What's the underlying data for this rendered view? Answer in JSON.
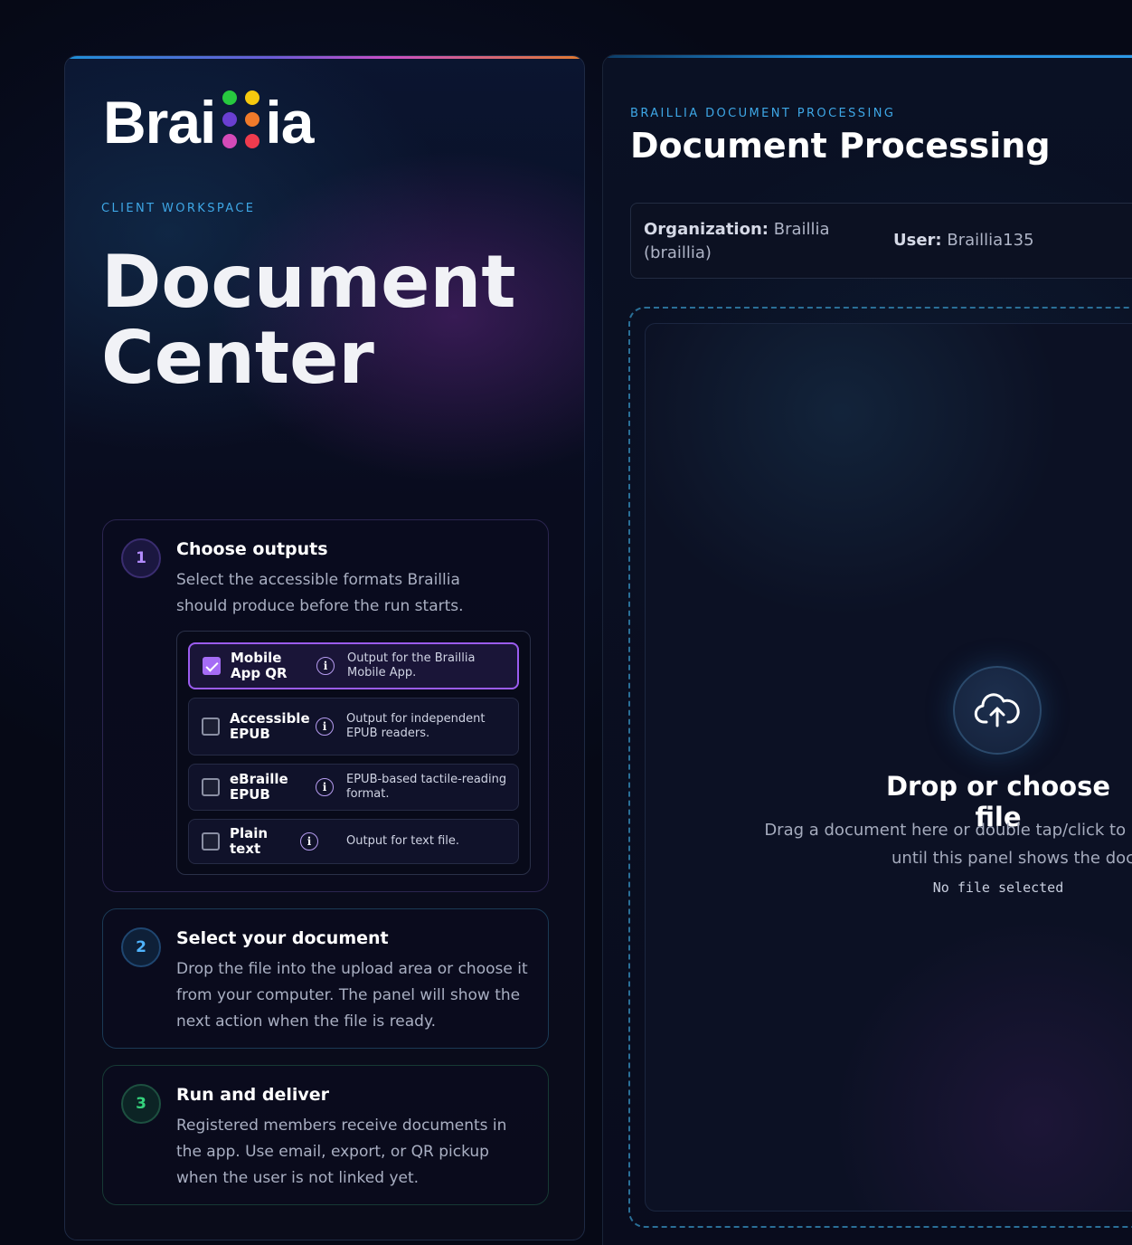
{
  "brand": {
    "logo_text_left": "Brai",
    "logo_text_right": "ia",
    "dot_colors": [
      "#27c93f",
      "#f6c90e",
      "#6a3fd1",
      "#f07a2a",
      "#d44ab8",
      "#ef3b4e"
    ]
  },
  "left": {
    "eyebrow": "CLIENT WORKSPACE",
    "title": "Document Center",
    "steps": [
      {
        "number": "1",
        "title": "Choose outputs",
        "description": "Select the accessible formats Braillia should produce before the run starts.",
        "options": [
          {
            "label": "Mobile App QR",
            "description": "Output for the Braillia Mobile App.",
            "checked": true
          },
          {
            "label": "Accessible EPUB",
            "description": "Output for independent EPUB readers.",
            "checked": false
          },
          {
            "label": "eBraille EPUB",
            "description": "EPUB-based tactile-reading format.",
            "checked": false
          },
          {
            "label": "Plain text",
            "description": "Output for text file.",
            "checked": false
          }
        ]
      },
      {
        "number": "2",
        "title": "Select your document",
        "description": "Drop the file into the upload area or choose it from your computer. The panel will show the next action when the file is ready."
      },
      {
        "number": "3",
        "title": "Run and deliver",
        "description": "Registered members receive documents in the app. Use email, export, or QR pickup when the user is not linked yet."
      }
    ]
  },
  "right": {
    "eyebrow": "BRAILLIA DOCUMENT PROCESSING",
    "title": "Document Processing",
    "org_label": "Organization:",
    "org_value": "Braillia (braillia)",
    "user_label": "User:",
    "user_value": "Braillia135",
    "dropzone": {
      "icon": "cloud-upload-icon",
      "title": "Drop or choose file",
      "description_line1": "Drag a document here or double tap/click to browse. Brai",
      "description_line2": "until this panel shows the document-ready a",
      "status": "No file selected"
    }
  },
  "colors": {
    "accent_purple": "#9b5cf0",
    "accent_blue": "#3ea7e6",
    "step1": "#b38cff",
    "step2": "#4fb4ff",
    "step3": "#34d27c"
  }
}
